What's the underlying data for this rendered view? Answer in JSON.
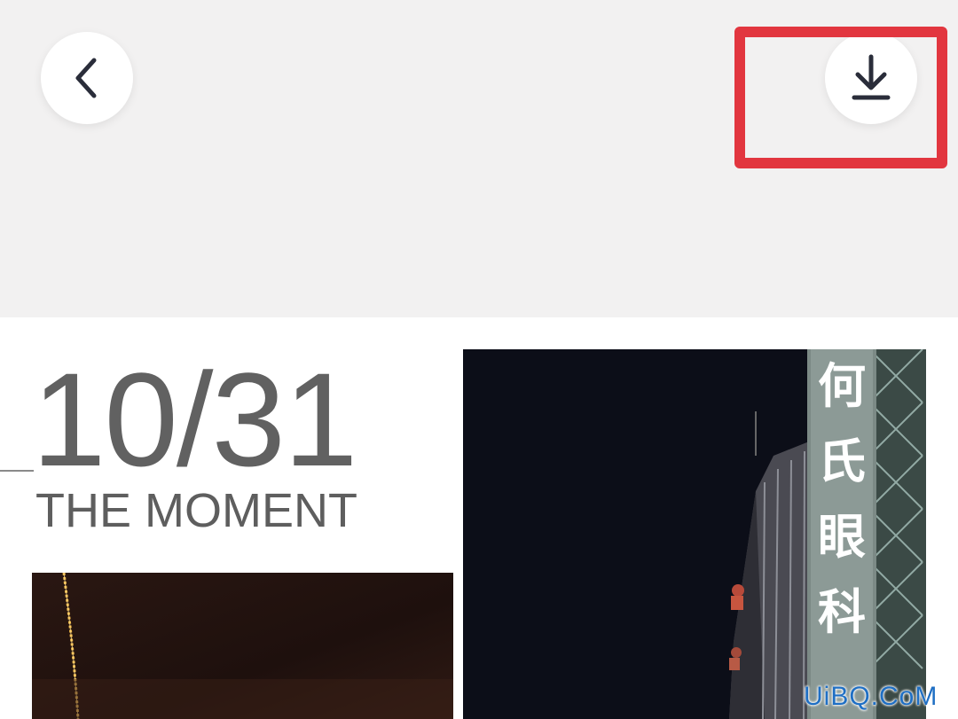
{
  "header": {
    "back_icon": "chevron-left-icon",
    "download_icon": "download-icon",
    "highlight_color": "#e2363f"
  },
  "card": {
    "date": "10/31",
    "subtitle": "THE MOMENT"
  },
  "photo": {
    "sign_chars": [
      "何",
      "氏",
      "眼",
      "科"
    ]
  },
  "watermark": "UiBQ.CoM"
}
